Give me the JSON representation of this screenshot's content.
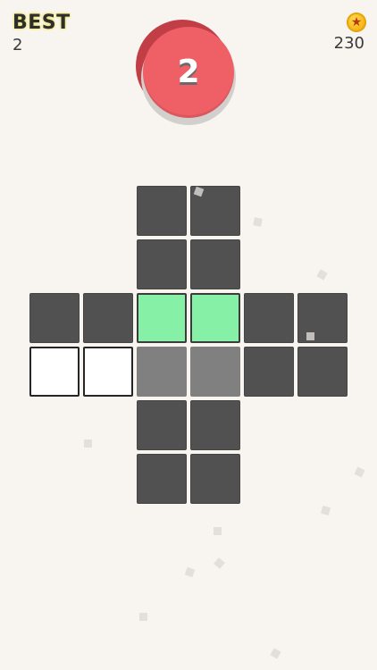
{
  "hud": {
    "best_label": "BEST",
    "best_value": "2",
    "coins_value": "230",
    "coin_icon": "star-coin-icon"
  },
  "level": {
    "number": "2"
  },
  "colors": {
    "background": "#f8f5f1",
    "dark_tile": "#515151",
    "green_tile": "#86f0a6",
    "grey_tile": "#808080",
    "white_tile": "#ffffff",
    "level_red": "#ee5f66"
  },
  "board": {
    "rows": [
      [
        "empty",
        "empty",
        "dark",
        "dark",
        "empty",
        "empty"
      ],
      [
        "empty",
        "empty",
        "dark",
        "dark",
        "empty",
        "empty"
      ],
      [
        "dark",
        "dark",
        "green",
        "green",
        "dark",
        "dark"
      ],
      [
        "white",
        "white",
        "grey",
        "grey",
        "dark",
        "dark"
      ],
      [
        "empty",
        "empty",
        "dark",
        "dark",
        "empty",
        "empty"
      ],
      [
        "empty",
        "empty",
        "dark",
        "dark",
        "empty",
        "empty"
      ]
    ]
  }
}
